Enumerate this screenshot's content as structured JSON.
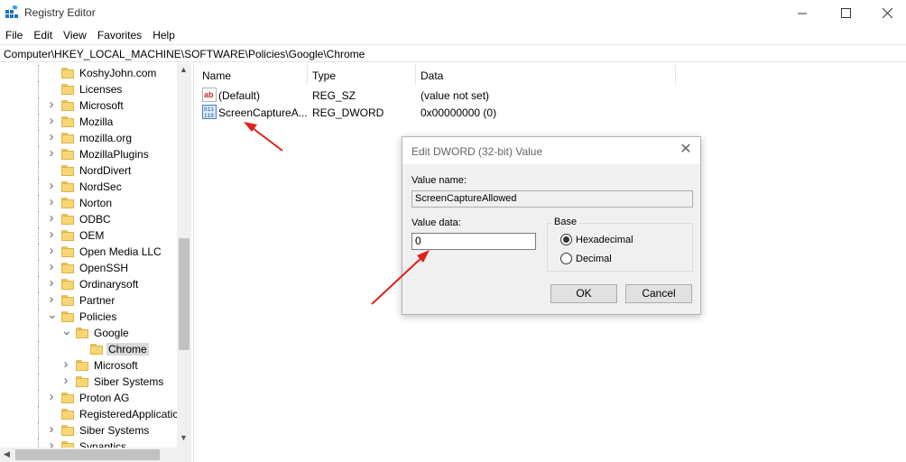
{
  "window": {
    "title": "Registry Editor",
    "icon": "regedit-icon",
    "controls": {
      "minimize": "—",
      "maximize": "☐",
      "close": "✕"
    }
  },
  "menu": [
    "File",
    "Edit",
    "View",
    "Favorites",
    "Help"
  ],
  "address": "Computer\\HKEY_LOCAL_MACHINE\\SOFTWARE\\Policies\\Google\\Chrome",
  "tree": [
    {
      "label": "KoshyJohn.com",
      "level": 0,
      "expander": ""
    },
    {
      "label": "Licenses",
      "level": 0,
      "expander": ""
    },
    {
      "label": "Microsoft",
      "level": 0,
      "expander": ">"
    },
    {
      "label": "Mozilla",
      "level": 0,
      "expander": ">"
    },
    {
      "label": "mozilla.org",
      "level": 0,
      "expander": ">"
    },
    {
      "label": "MozillaPlugins",
      "level": 0,
      "expander": ">"
    },
    {
      "label": "NordDivert",
      "level": 0,
      "expander": ""
    },
    {
      "label": "NordSec",
      "level": 0,
      "expander": ">"
    },
    {
      "label": "Norton",
      "level": 0,
      "expander": ">"
    },
    {
      "label": "ODBC",
      "level": 0,
      "expander": ">"
    },
    {
      "label": "OEM",
      "level": 0,
      "expander": ">"
    },
    {
      "label": "Open Media LLC",
      "level": 0,
      "expander": ">"
    },
    {
      "label": "OpenSSH",
      "level": 0,
      "expander": ">"
    },
    {
      "label": "Ordinarysoft",
      "level": 0,
      "expander": ">"
    },
    {
      "label": "Partner",
      "level": 0,
      "expander": ">"
    },
    {
      "label": "Policies",
      "level": 0,
      "expander": "v"
    },
    {
      "label": "Google",
      "level": 1,
      "expander": "v"
    },
    {
      "label": "Chrome",
      "level": 2,
      "expander": "",
      "selected": true
    },
    {
      "label": "Microsoft",
      "level": 1,
      "expander": ">"
    },
    {
      "label": "Siber Systems",
      "level": 1,
      "expander": ">"
    },
    {
      "label": "Proton AG",
      "level": 0,
      "expander": ">"
    },
    {
      "label": "RegisteredApplicatic",
      "level": 0,
      "expander": ""
    },
    {
      "label": "Siber Systems",
      "level": 0,
      "expander": ">"
    },
    {
      "label": "Synaptics",
      "level": 0,
      "expander": ">"
    }
  ],
  "list": {
    "headers": {
      "name": "Name",
      "type": "Type",
      "data": "Data"
    },
    "rows": [
      {
        "icon": "string-value-icon",
        "glyph": "ab",
        "name": "(Default)",
        "type": "REG_SZ",
        "data": "(value not set)"
      },
      {
        "icon": "dword-value-icon",
        "glyph": "011\n110",
        "name": "ScreenCaptureA...",
        "type": "REG_DWORD",
        "data": "0x00000000 (0)"
      }
    ]
  },
  "dialog": {
    "title": "Edit DWORD (32-bit) Value",
    "value_name_label": "Value name:",
    "value_name": "ScreenCaptureAllowed",
    "value_data_label": "Value data:",
    "value_data": "0",
    "base_label": "Base",
    "hex_label": "Hexadecimal",
    "dec_label": "Decimal",
    "base_selected": "Hexadecimal",
    "ok_label": "OK",
    "cancel_label": "Cancel",
    "close_glyph": "✕"
  },
  "colors": {
    "annotation_arrow": "#e0201b",
    "folder_fill": "#f7d774",
    "selection": "#d9d9d9"
  }
}
